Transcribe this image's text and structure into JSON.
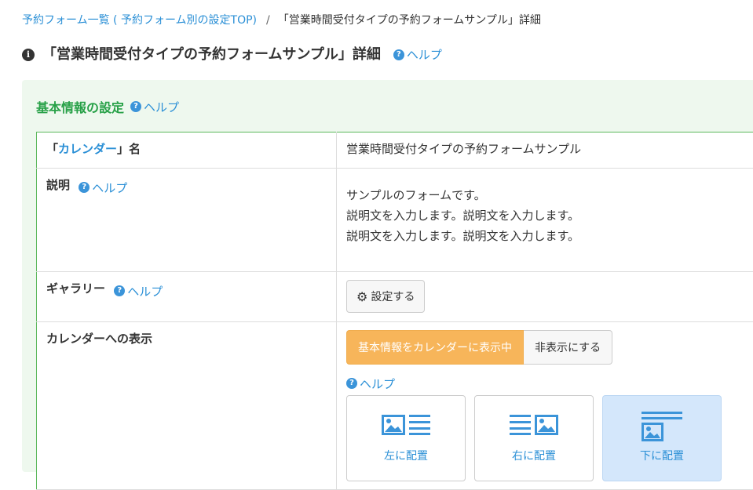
{
  "breadcrumb": {
    "parent": "予約フォーム一覧 ( 予約フォーム別の設定TOP)",
    "separator": "/",
    "current": "「営業時間受付タイプの予約フォームサンプル」詳細"
  },
  "page": {
    "title": "「営業時間受付タイプの予約フォームサンプル」詳細",
    "help": "ヘルプ"
  },
  "panel": {
    "title": "基本情報の設定",
    "help": "ヘルプ"
  },
  "rows": {
    "calendar_name": {
      "label_open": "「",
      "label_link": "カレンダー",
      "label_close": "」名",
      "value": "営業時間受付タイプの予約フォームサンプル"
    },
    "description": {
      "label": "説明",
      "help": "ヘルプ",
      "lines": [
        "サンプルのフォームです。",
        "説明文を入力します。説明文を入力します。",
        "説明文を入力します。説明文を入力します。"
      ]
    },
    "gallery": {
      "label": "ギャラリー",
      "help": "ヘルプ",
      "button": "設定する"
    },
    "calendar_display": {
      "label": "カレンダーへの表示",
      "active_button": "基本情報をカレンダーに表示中",
      "hide_button": "非表示にする",
      "help": "ヘルプ",
      "layouts": [
        {
          "label": "左に配置",
          "icon": "image-left-icon",
          "selected": false
        },
        {
          "label": "右に配置",
          "icon": "image-right-icon",
          "selected": false
        },
        {
          "label": "下に配置",
          "icon": "image-bottom-icon",
          "selected": true
        }
      ]
    }
  },
  "colors": {
    "link": "#2a8fd6",
    "panel_title": "#28a148",
    "panel_bg": "#eef8ee",
    "active_button": "#f7b55a",
    "selected_card": "#d4e7fb"
  }
}
